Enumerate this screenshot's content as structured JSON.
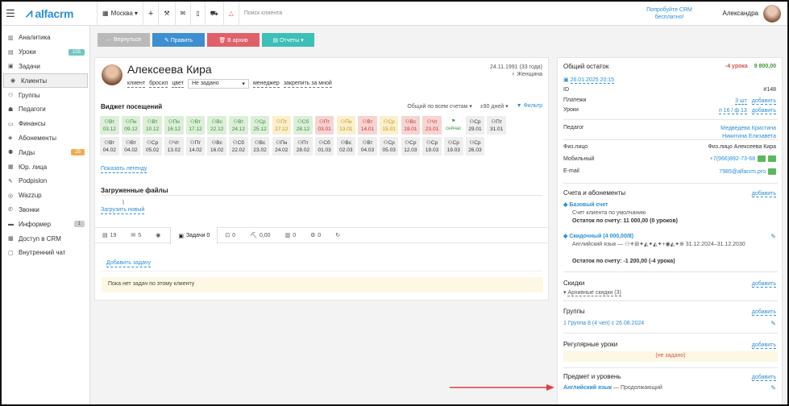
{
  "topbar": {
    "logo_text": "alfacrm",
    "city": "Москва",
    "search_placeholder": "Поиск клиента",
    "promo": "Попробуйте CRM бесплатно!",
    "user_name": "Александра"
  },
  "sidebar": {
    "items": [
      {
        "label": "Аналитика",
        "icon": "chart-icon"
      },
      {
        "label": "Уроки",
        "icon": "lessons-icon",
        "badge": "105"
      },
      {
        "label": "Задачи",
        "icon": "tasks-icon"
      },
      {
        "label": "Клиенты",
        "icon": "user-icon",
        "active": true
      },
      {
        "label": "Группы",
        "icon": "group-icon"
      },
      {
        "label": "Педагоги",
        "icon": "teacher-icon"
      },
      {
        "label": "Финансы",
        "icon": "finance-icon"
      },
      {
        "label": "Абонементы",
        "icon": "subscription-icon"
      },
      {
        "label": "Лиды",
        "icon": "leads-icon",
        "badge": "25"
      },
      {
        "label": "Юр. лица",
        "icon": "legal-icon"
      },
      {
        "label": "Podpislon",
        "icon": "sign-icon"
      },
      {
        "label": "Wazzup",
        "icon": "chat-icon"
      },
      {
        "label": "Звонки",
        "icon": "phone-icon"
      },
      {
        "label": "Информер",
        "icon": "informer-icon",
        "badge": "1"
      },
      {
        "label": "Доступ в CRM",
        "icon": "lock-icon"
      },
      {
        "label": "Внутренний чат",
        "icon": "chat-bubble-icon"
      }
    ]
  },
  "toolbar": {
    "back": "← Вернуться",
    "edit": "✎ Править",
    "archive": "🗑 В архив",
    "reports": "▤ Отчеты ▾"
  },
  "client": {
    "name": "Алексеева Кира",
    "birth": "24.11.1991 (33 года)",
    "gender": "Женщина",
    "tags": [
      "клиент",
      "бросил",
      "цвет"
    ],
    "status_select": "Не задано",
    "manager_label": "менеджер",
    "assign_label": "закрепить за мной"
  },
  "visits": {
    "title": "Виджет посещений",
    "filter_total": "Общий по всем счетам",
    "filter_days": "±90 дней",
    "filter_btn": "Фильтр",
    "legend_link": "Показать легенду",
    "row1": [
      {
        "d": "Вт",
        "date": "03.12",
        "s": "green"
      },
      {
        "d": "Пн",
        "date": "09.12",
        "s": "green"
      },
      {
        "d": "Вт",
        "date": "10.12",
        "s": "green"
      },
      {
        "d": "Пн",
        "date": "16.12",
        "s": "green"
      },
      {
        "d": "Вт",
        "date": "17.12",
        "s": "green"
      },
      {
        "d": "Вс",
        "date": "22.12",
        "s": "green"
      },
      {
        "d": "Вт",
        "date": "24.12",
        "s": "green"
      },
      {
        "d": "Ср",
        "date": "25.12",
        "s": "green"
      },
      {
        "d": "Пт",
        "date": "27.12",
        "s": "yellow"
      },
      {
        "d": "Сб",
        "date": "28.12",
        "s": "green"
      },
      {
        "d": "Пт",
        "date": "03.01",
        "s": "red"
      },
      {
        "d": "Пн",
        "date": "13.01",
        "s": "yellow"
      },
      {
        "d": "Вт",
        "date": "14.01",
        "s": "red"
      },
      {
        "d": "Ср",
        "date": "15.01",
        "s": "yellow"
      },
      {
        "d": "Вс",
        "date": "19.01",
        "s": "red"
      },
      {
        "d": "Чт",
        "date": "23.01",
        "s": "red"
      },
      {
        "d": "",
        "date": "сейчас",
        "s": "now"
      },
      {
        "d": "Ср",
        "date": "29.01",
        "s": "gray"
      },
      {
        "d": "Пт",
        "date": "31.01",
        "s": "gray"
      }
    ],
    "row2": [
      {
        "d": "Вт",
        "date": "04.02"
      },
      {
        "d": "Вт",
        "date": "04.02"
      },
      {
        "d": "Ср",
        "date": "05.02"
      },
      {
        "d": "Чт",
        "date": "13.02"
      },
      {
        "d": "Пт",
        "date": "14.02"
      },
      {
        "d": "Вс",
        "date": "16.02"
      },
      {
        "d": "Сб",
        "date": "22.02"
      },
      {
        "d": "Вс",
        "date": "23.02"
      },
      {
        "d": "Пн",
        "date": "24.02"
      },
      {
        "d": "Пт",
        "date": "28.02"
      },
      {
        "d": "Сб",
        "date": "01.03"
      },
      {
        "d": "Вс",
        "date": "02.03"
      },
      {
        "d": "Вт",
        "date": "04.03"
      },
      {
        "d": "Ср",
        "date": "05.03"
      },
      {
        "d": "Ср",
        "date": "12.03"
      },
      {
        "d": "Ср",
        "date": "19.03"
      },
      {
        "d": "Ср",
        "date": "19.03"
      },
      {
        "d": "Ср",
        "date": "26.03"
      }
    ]
  },
  "files": {
    "title": "Загруженные файлы",
    "upload": "Загрузить новый"
  },
  "tabs": [
    {
      "icon": "▤",
      "label": "19"
    },
    {
      "icon": "✉",
      "label": "5"
    },
    {
      "icon": "◉",
      "label": ""
    },
    {
      "icon": "▣",
      "label": "Задачи 0",
      "active": true
    },
    {
      "icon": "⊡",
      "label": "0"
    },
    {
      "icon": "⛏",
      "label": "0,00"
    },
    {
      "icon": "▥",
      "label": "0"
    },
    {
      "icon": "⚙",
      "label": "0"
    },
    {
      "icon": "↻",
      "label": ""
    }
  ],
  "tasks": {
    "add": "Добавить задачу",
    "empty": "Пока нет задач по этому клиенту"
  },
  "right": {
    "balance_title": "Общий остаток",
    "balance_lessons": "-4 урока",
    "balance_money": "9 800,00",
    "date": "26.01.2025 20:15",
    "id_label": "ID",
    "id_value": "#148",
    "payments_label": "Платежи",
    "payments_value": "3 шт",
    "lessons_label": "Уроки",
    "lessons_value": "п 16 / ф 13",
    "add": "добавить",
    "teacher_label": "Педагог",
    "teachers": [
      "Медведева Кристина",
      "Никитина Елизавета"
    ],
    "person_label": "Физ.лицо",
    "person_value": "Физ.лицо Алексеева Кира",
    "mobile_label": "Мобильный",
    "mobile_value": "+7(966)892-73-68",
    "email_label": "E-mail",
    "email_value": "7985@alfacrm.pro",
    "accounts_title": "Счета и абонементы",
    "base_account": "Базовый счет",
    "base_desc": "Счет клиента по умолчанию",
    "base_rest": "Остаток по счету: 11 000,00 (0 уроков)",
    "discount_account": "Скидочный (4 000,00/8)",
    "discount_desc": "Английский язык — ⚇✳⊞✦◭✦◭✦+◉◭✦⊕ 31.12.2024–31.12.2030",
    "discount_rest": "Остаток по счету: -1 200,00 (-4 урока)",
    "discounts_title": "Скидки",
    "discounts_archive": "Архивные скидки (3)",
    "groups_title": "Группы",
    "group_item": "1 Группа 8 (4 чел) с 26.08.2024",
    "regular_title": "Регулярные уроки",
    "regular_empty": "(не задано)",
    "subject_title": "Предмет и уровень",
    "subject_name": "Английский язык",
    "subject_level": "— Продолжающий"
  },
  "colors": {
    "brand": "#2d8fd5",
    "back_btn": "#b9b9b9",
    "edit_btn": "#3d8fd1",
    "archive_btn": "#e0606a",
    "reports_btn": "#3bbfb7",
    "arrow": "#e33d3d"
  }
}
